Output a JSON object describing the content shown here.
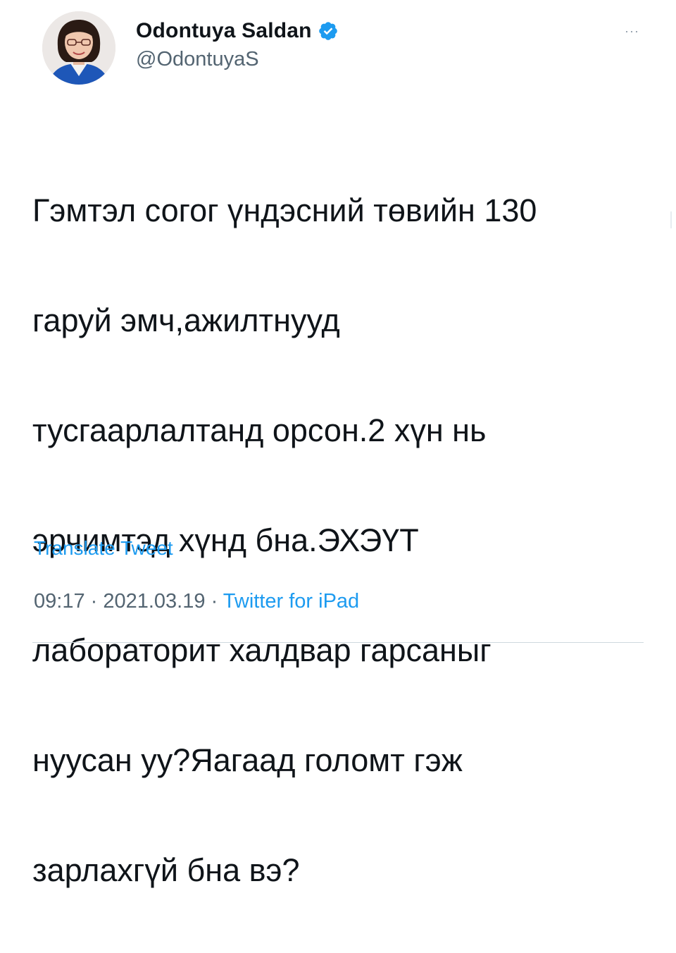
{
  "author": {
    "display_name": "Odontuya Saldan",
    "handle": "@OdontuyaS",
    "verified": true
  },
  "menu": {
    "more_icon": "···"
  },
  "tweet": {
    "text_lines": [
      "Гэмтэл согог үндэсний төвийн 130",
      "гаруй эмч,ажилтнууд",
      "тусгаарлалтанд орсон.2 хүн нь",
      "эрчимтэд хүнд бна.ЭХЭҮТ",
      "лабораторит халдвар гарсаныг",
      "нуусан уу?Яагаад голомт гэж",
      "зарлахгүй бна вэ?"
    ],
    "translate_label": "Translate Tweet",
    "time": "09:17",
    "separator": " · ",
    "date": "2021.03.19",
    "source": "Twitter for iPad"
  },
  "colors": {
    "accent": "#1d9bf0",
    "secondary_text": "#536471",
    "primary_text": "#0f1419"
  }
}
